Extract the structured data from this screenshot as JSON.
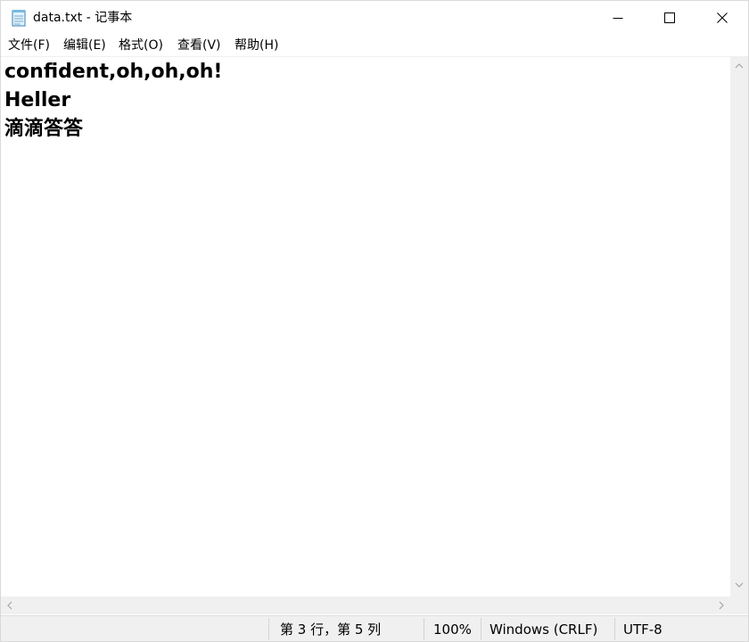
{
  "window": {
    "title": "data.txt - 记事本",
    "controls": {
      "minimize": "minimize-icon",
      "maximize": "maximize-icon",
      "close": "close-icon"
    }
  },
  "menu": {
    "items": [
      {
        "label": "文件(F)"
      },
      {
        "label": "编辑(E)"
      },
      {
        "label": "格式(O)"
      },
      {
        "label": "查看(V)"
      },
      {
        "label": "帮助(H)"
      }
    ]
  },
  "editor": {
    "lines": [
      "confident,oh,oh,oh!",
      "Heller",
      "滴滴答答"
    ]
  },
  "status": {
    "position": "第 3 行，第 5 列",
    "zoom": "100%",
    "line_ending": "Windows (CRLF)",
    "encoding": "UTF-8"
  },
  "colors": {
    "chrome_background": "#f0f0f0",
    "editor_background": "#ffffff",
    "text": "#000000"
  }
}
